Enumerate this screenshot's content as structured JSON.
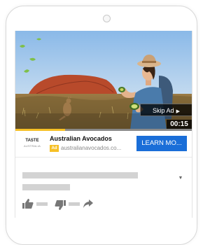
{
  "ad": {
    "skip_label": "Skip Ad",
    "skip_arrow": "▶",
    "timer": "00:15",
    "progress_fraction": 0.28,
    "advertiser_name": "Australian Avocados",
    "ad_badge": "Ad",
    "url": "australianavocados.co...",
    "cta_label": "LEARN MO...",
    "logo_text_line1": "TASTE",
    "logo_text_line2": "AUSTRALIA",
    "colors": {
      "progress": "#f6c026",
      "cta": "#1a6ed8",
      "badge": "#f6c026"
    }
  },
  "icons": {
    "expand": "chevron-down-icon",
    "like": "thumbs-up-icon",
    "dislike": "thumbs-down-icon",
    "share": "share-icon"
  }
}
